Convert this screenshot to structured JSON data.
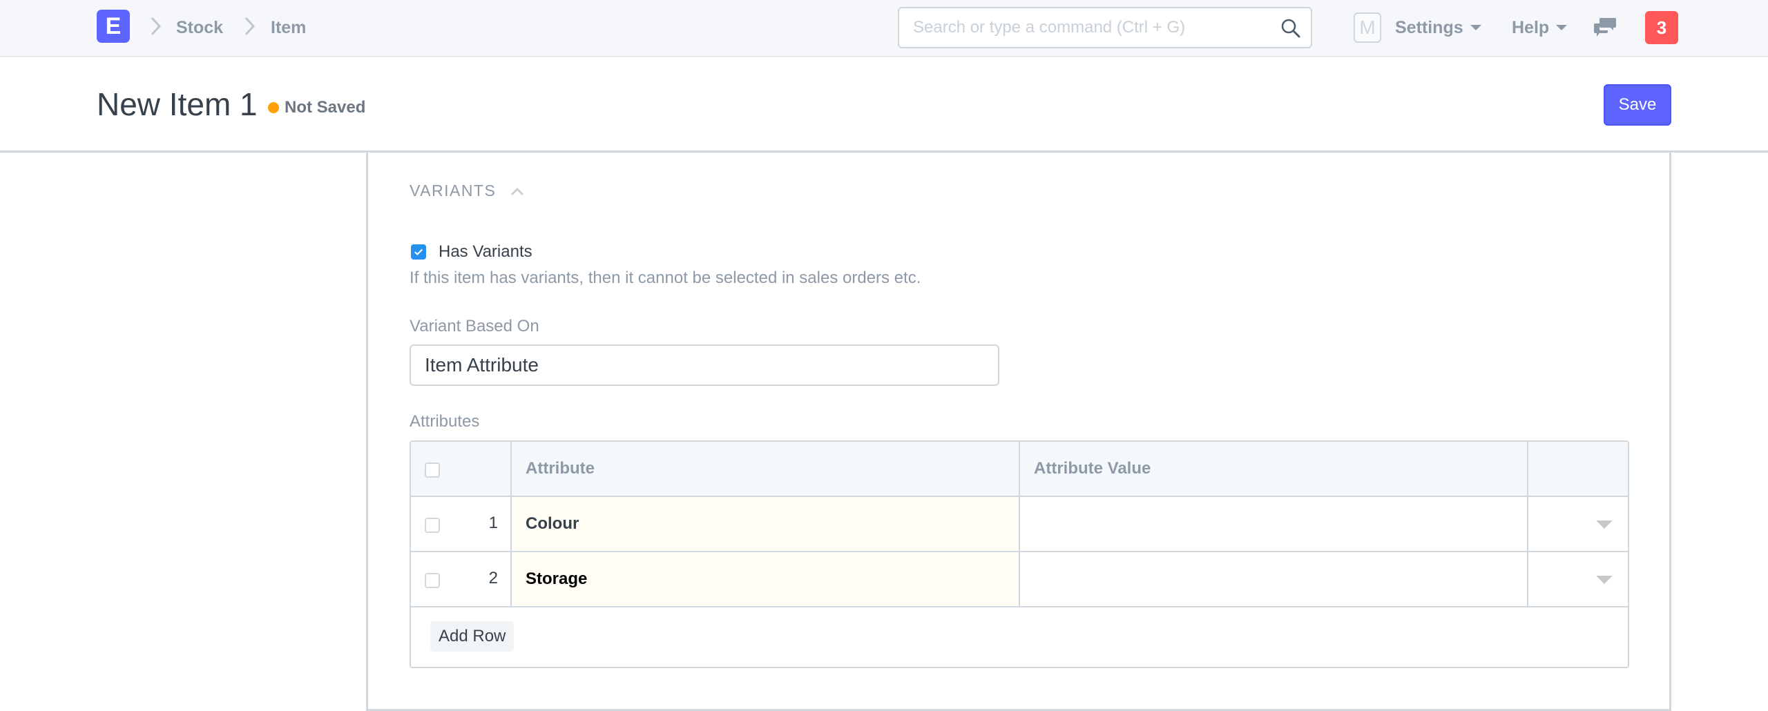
{
  "navbar": {
    "logo_letter": "E",
    "breadcrumbs": [
      "Stock",
      "Item"
    ],
    "search_placeholder": "Search or type a command (Ctrl + G)",
    "avatar_letter": "M",
    "settings_label": "Settings",
    "help_label": "Help",
    "notification_count": "3"
  },
  "page_head": {
    "title": "New Item 1",
    "status": "Not Saved",
    "status_color": "#ffa00a",
    "save_label": "Save"
  },
  "section": {
    "title": "VARIANTS",
    "has_variants_label": "Has Variants",
    "has_variants_checked": true,
    "has_variants_help": "If this item has variants, then it cannot be selected in sales orders etc.",
    "variant_based_on_label": "Variant Based On",
    "variant_based_on_value": "Item Attribute",
    "attributes_label": "Attributes"
  },
  "grid": {
    "columns": [
      "Attribute",
      "Attribute Value"
    ],
    "rows": [
      {
        "idx": "1",
        "attribute": "Colour",
        "attribute_value": ""
      },
      {
        "idx": "2",
        "attribute": "Storage",
        "attribute_value": ""
      }
    ],
    "add_row_label": "Add Row"
  },
  "colors": {
    "primary": "#5e64ff",
    "danger": "#ff5858",
    "checkbox": "#2490ef"
  }
}
